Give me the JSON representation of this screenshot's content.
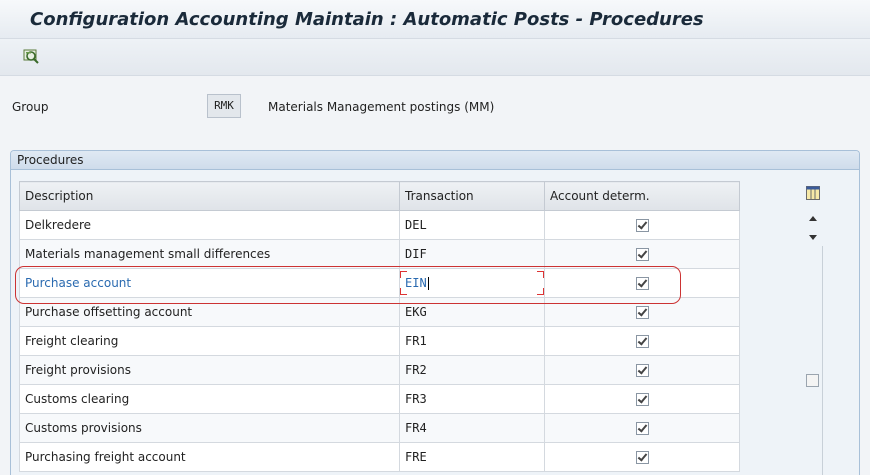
{
  "title": "Configuration Accounting Maintain : Automatic Posts - Procedures",
  "toolbar": {
    "icon": "display-settings-icon"
  },
  "group": {
    "label": "Group",
    "code": "RMK",
    "description": "Materials Management postings (MM)"
  },
  "panel": {
    "title": "Procedures"
  },
  "table": {
    "columns": [
      "Description",
      "Transaction",
      "Account determ."
    ],
    "rows": [
      {
        "description": "Delkredere",
        "transaction": "DEL",
        "account_determ": true
      },
      {
        "description": "Materials management small differences",
        "transaction": "DIF",
        "account_determ": true
      },
      {
        "description": "Purchase account",
        "transaction": "EIN",
        "account_determ": true
      },
      {
        "description": "Purchase offsetting account",
        "transaction": "EKG",
        "account_determ": true
      },
      {
        "description": "Freight clearing",
        "transaction": "FR1",
        "account_determ": true
      },
      {
        "description": "Freight provisions",
        "transaction": "FR2",
        "account_determ": true
      },
      {
        "description": "Customs clearing",
        "transaction": "FR3",
        "account_determ": true
      },
      {
        "description": "Customs provisions",
        "transaction": "FR4",
        "account_determ": true
      },
      {
        "description": "Purchasing freight account",
        "transaction": "FRE",
        "account_determ": true
      }
    ]
  },
  "colors": {
    "highlight": "#cc3333",
    "selected_text": "#2a6ab0",
    "panel_border": "#a8c0d8"
  }
}
